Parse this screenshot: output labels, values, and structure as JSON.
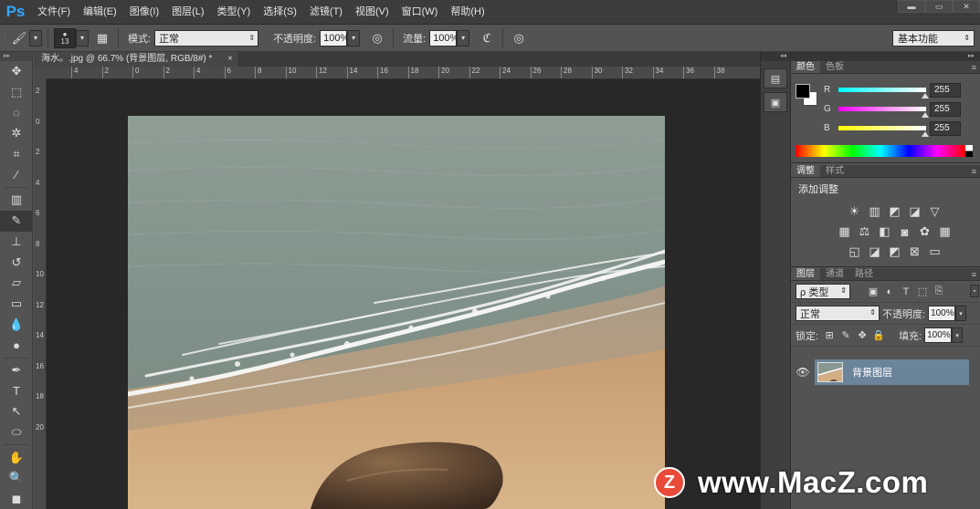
{
  "app": {
    "logo": "Ps"
  },
  "menu": [
    "文件(F)",
    "编辑(E)",
    "图像(I)",
    "图层(L)",
    "类型(Y)",
    "选择(S)",
    "滤镜(T)",
    "视图(V)",
    "窗口(W)",
    "帮助(H)"
  ],
  "window_controls": {
    "minimize": "▬",
    "restore": "▭",
    "close": "✕"
  },
  "options": {
    "brush_size": "13",
    "mode_label": "模式:",
    "mode_value": "正常",
    "opacity_label": "不透明度:",
    "opacity_value": "100%",
    "flow_label": "流量:",
    "flow_value": "100%",
    "workspace": "基本功能"
  },
  "document": {
    "tab_title": "海水。.jpg @ 66.7% (背景图层, RGB/8#) *",
    "tab_close": "×",
    "ruler_h": [
      "4",
      "2",
      "0",
      "2",
      "4",
      "6",
      "8",
      "10",
      "12",
      "14",
      "16",
      "18",
      "20",
      "22",
      "24",
      "26",
      "28",
      "30",
      "32",
      "34",
      "36",
      "38"
    ],
    "ruler_v": [
      "2",
      "0",
      "2",
      "4",
      "6",
      "8",
      "10",
      "12",
      "14",
      "16",
      "18",
      "20"
    ]
  },
  "color_panel": {
    "tabs": [
      "颜色",
      "色板"
    ],
    "channels": [
      {
        "label": "R",
        "value": "255",
        "gradient": [
          "#00ffff",
          "#ffffff"
        ]
      },
      {
        "label": "G",
        "value": "255",
        "gradient": [
          "#ff00ff",
          "#ffffff"
        ]
      },
      {
        "label": "B",
        "value": "255",
        "gradient": [
          "#ffff00",
          "#ffffff"
        ]
      }
    ],
    "foreground": "#000000",
    "background": "#ffffff"
  },
  "adjustments_panel": {
    "tabs": [
      "调整",
      "样式"
    ],
    "title": "添加调整"
  },
  "layers_panel": {
    "tabs": [
      "图层",
      "通道",
      "路径"
    ],
    "filter": "ρ 类型",
    "blend_mode": "正常",
    "opacity_label": "不透明度:",
    "opacity_value": "100%",
    "lock_label": "锁定:",
    "fill_label": "填充:",
    "fill_value": "100%",
    "layers": [
      {
        "name": "背景图层",
        "selected": true
      }
    ]
  },
  "watermark": {
    "badge": "Z",
    "text": "www.MacZ.com"
  }
}
